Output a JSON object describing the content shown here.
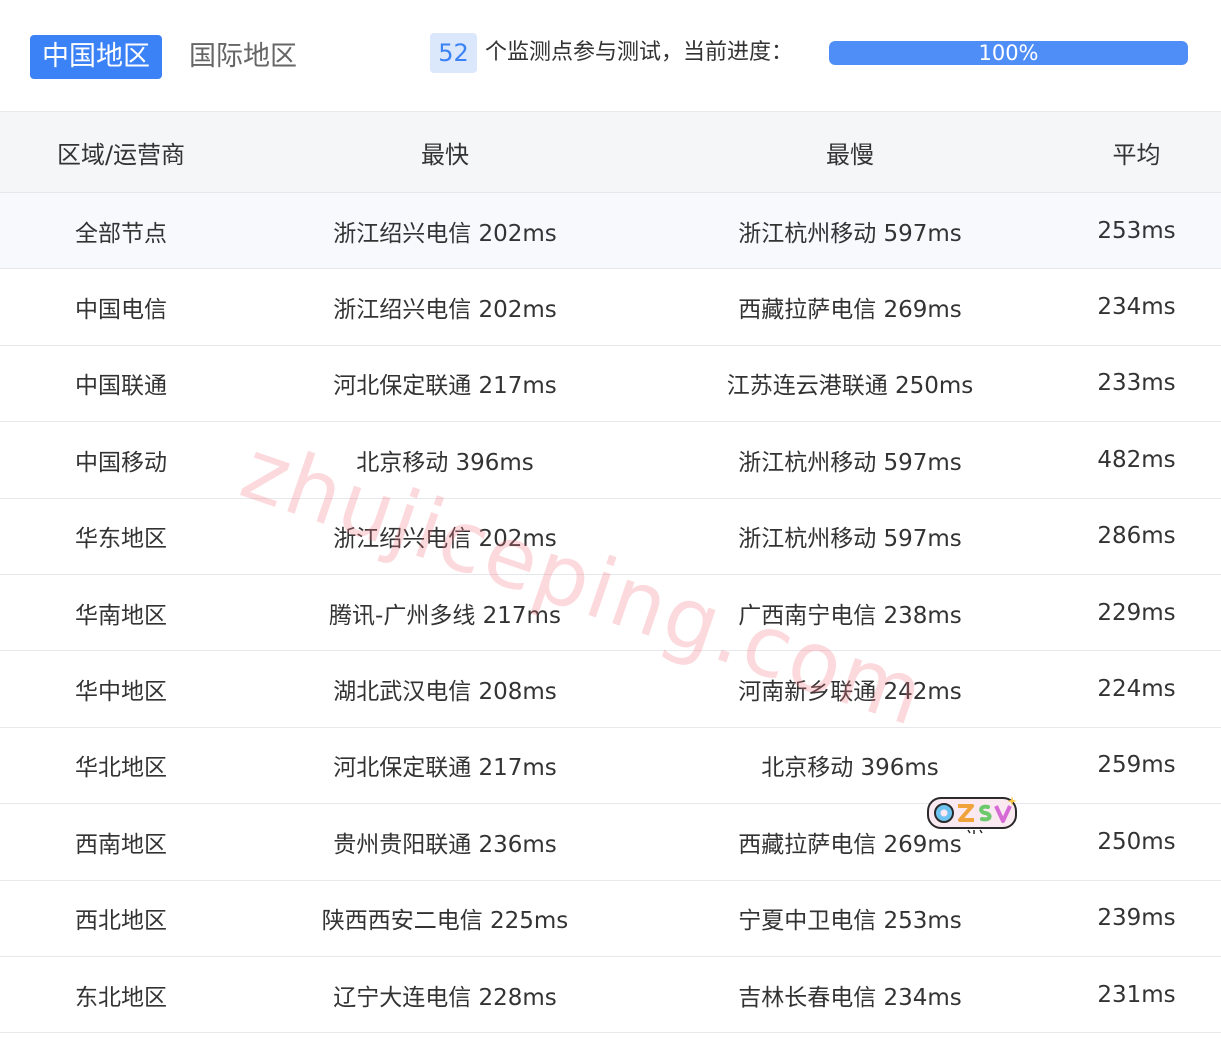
{
  "tabs": [
    {
      "label": "中国地区",
      "active": true
    },
    {
      "label": "国际地区",
      "active": false
    }
  ],
  "status": {
    "monitor_count": "52",
    "text": "个监测点参与测试，当前进度：",
    "progress": 1.0,
    "progress_label": "100%"
  },
  "table": {
    "headers": [
      "区域/运营商",
      "最快",
      "最慢",
      "平均"
    ],
    "rows": [
      [
        "全部节点",
        "浙江绍兴电信 202ms",
        "浙江杭州移动 597ms",
        "253ms"
      ],
      [
        "中国电信",
        "浙江绍兴电信 202ms",
        "西藏拉萨电信 269ms",
        "234ms"
      ],
      [
        "中国联通",
        "河北保定联通 217ms",
        "江苏连云港联通 250ms",
        "233ms"
      ],
      [
        "中国移动",
        "北京移动 396ms",
        "浙江杭州移动 597ms",
        "482ms"
      ],
      [
        "华东地区",
        "浙江绍兴电信 202ms",
        "浙江杭州移动 597ms",
        "286ms"
      ],
      [
        "华南地区",
        "腾讯-广州多线 217ms",
        "广西南宁电信 238ms",
        "229ms"
      ],
      [
        "华中地区",
        "湖北武汉电信 208ms",
        "河南新乡联通 242ms",
        "224ms"
      ],
      [
        "华北地区",
        "河北保定联通 217ms",
        "北京移动 396ms",
        "259ms"
      ],
      [
        "西南地区",
        "贵州贵阳联通 236ms",
        "西藏拉萨电信 269ms",
        "250ms"
      ],
      [
        "西北地区",
        "陕西西安二电信 225ms",
        "宁夏中卫电信 253ms",
        "239ms"
      ],
      [
        "东北地区",
        "辽宁大连电信 228ms",
        "吉林长春电信 234ms",
        "231ms"
      ]
    ]
  },
  "watermark": "zhujiceping.com",
  "logo_text": "OZSV",
  "colors": {
    "accent": "#3b82f6",
    "badge_bg": "#dbe7fb",
    "header_bg": "#f5f6f8",
    "watermark": "#f57882"
  }
}
